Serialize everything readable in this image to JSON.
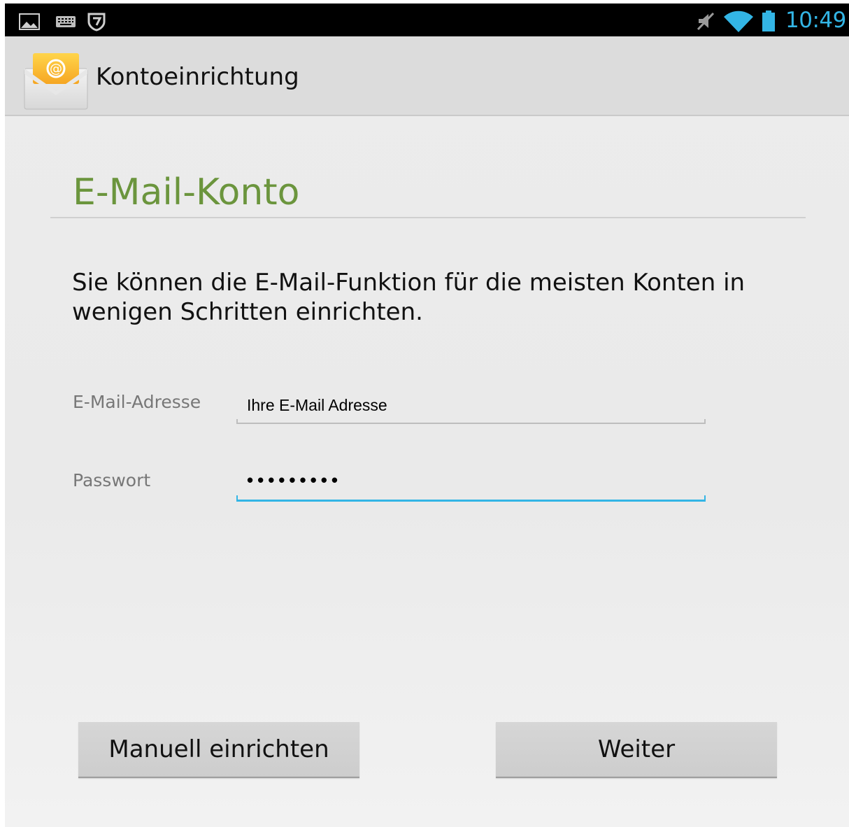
{
  "status_bar": {
    "time": "10:49",
    "accent_color": "#33b5e5",
    "icons": [
      "gallery-icon",
      "keyboard-icon",
      "shield-icon",
      "mute-icon",
      "wifi-icon",
      "battery-icon"
    ]
  },
  "action_bar": {
    "title": "Kontoeinrichtung",
    "app_icon": "email-app-icon"
  },
  "main": {
    "heading": "E-Mail-Konto",
    "heading_color": "#6b953d",
    "description": "Sie können die E-Mail-Funktion für die meisten Konten in wenigen Schritten einrichten."
  },
  "form": {
    "email_label": "E-Mail-Adresse",
    "email_value": "Ihre E-Mail Adresse",
    "password_label": "Passwort",
    "password_value": "•••••••••"
  },
  "buttons": {
    "manual_label": "Manuell einrichten",
    "next_label": "Weiter"
  }
}
